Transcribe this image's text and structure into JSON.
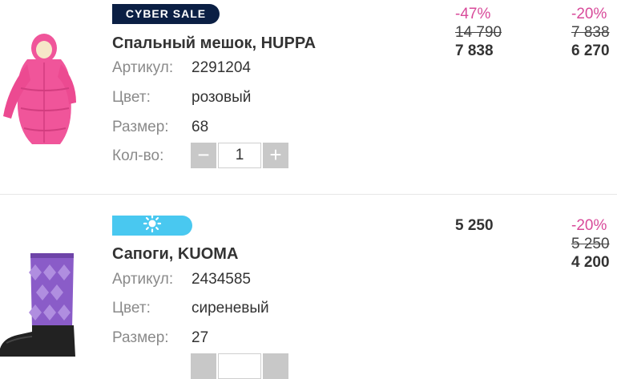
{
  "items": [
    {
      "badge": "CYBER SALE",
      "title": "Спальный мешок, HUPPA",
      "article_label": "Артикул:",
      "article": "2291204",
      "color_label": "Цвет:",
      "color": "розовый",
      "size_label": "Размер:",
      "size": "68",
      "qty_label": "Кол-во:",
      "qty": "1",
      "minus": "−",
      "plus": "+",
      "price_col1": {
        "discount": "-47%",
        "old": "14 790",
        "new": "7 838"
      },
      "price_col2": {
        "discount": "-20%",
        "old": "7 838",
        "new": "6 270"
      }
    },
    {
      "badge_icon": "sun-icon",
      "title": "Сапоги, KUOMA",
      "article_label": "Артикул:",
      "article": "2434585",
      "color_label": "Цвет:",
      "color": "сиреневый",
      "size_label": "Размер:",
      "size": "27",
      "price_col1": {
        "new": "5 250"
      },
      "price_col2": {
        "discount": "-20%",
        "old": "5 250",
        "new": "4 200"
      }
    }
  ],
  "colors": {
    "badge_dark": "#0b1f44",
    "badge_blue": "#49c8f0",
    "discount": "#d84a9a",
    "label_gray": "#8a8a8a",
    "product1": "#f0559a",
    "product2": "#8a5cc8"
  }
}
